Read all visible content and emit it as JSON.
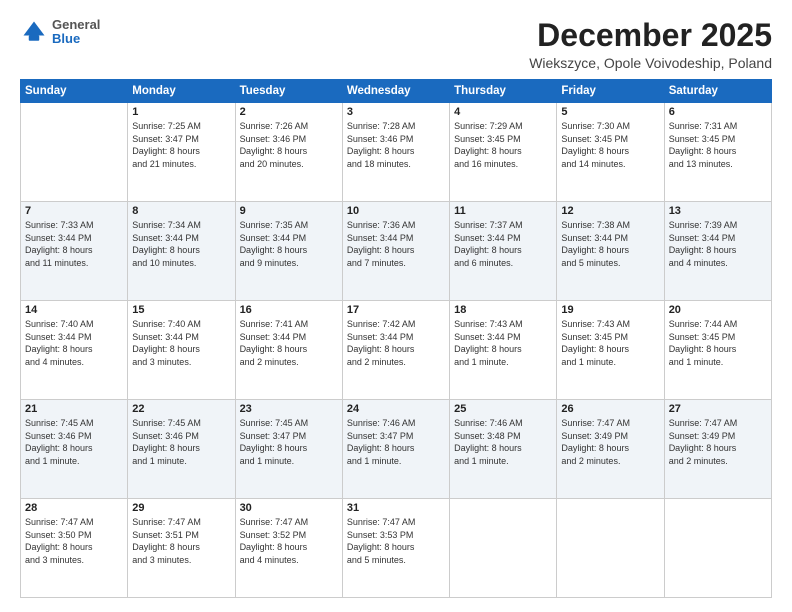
{
  "logo": {
    "general": "General",
    "blue": "Blue"
  },
  "header": {
    "month": "December 2025",
    "location": "Wiekszyce, Opole Voivodeship, Poland"
  },
  "weekdays": [
    "Sunday",
    "Monday",
    "Tuesday",
    "Wednesday",
    "Thursday",
    "Friday",
    "Saturday"
  ],
  "weeks": [
    [
      {
        "day": "",
        "info": ""
      },
      {
        "day": "1",
        "info": "Sunrise: 7:25 AM\nSunset: 3:47 PM\nDaylight: 8 hours\nand 21 minutes."
      },
      {
        "day": "2",
        "info": "Sunrise: 7:26 AM\nSunset: 3:46 PM\nDaylight: 8 hours\nand 20 minutes."
      },
      {
        "day": "3",
        "info": "Sunrise: 7:28 AM\nSunset: 3:46 PM\nDaylight: 8 hours\nand 18 minutes."
      },
      {
        "day": "4",
        "info": "Sunrise: 7:29 AM\nSunset: 3:45 PM\nDaylight: 8 hours\nand 16 minutes."
      },
      {
        "day": "5",
        "info": "Sunrise: 7:30 AM\nSunset: 3:45 PM\nDaylight: 8 hours\nand 14 minutes."
      },
      {
        "day": "6",
        "info": "Sunrise: 7:31 AM\nSunset: 3:45 PM\nDaylight: 8 hours\nand 13 minutes."
      }
    ],
    [
      {
        "day": "7",
        "info": "Sunrise: 7:33 AM\nSunset: 3:44 PM\nDaylight: 8 hours\nand 11 minutes."
      },
      {
        "day": "8",
        "info": "Sunrise: 7:34 AM\nSunset: 3:44 PM\nDaylight: 8 hours\nand 10 minutes."
      },
      {
        "day": "9",
        "info": "Sunrise: 7:35 AM\nSunset: 3:44 PM\nDaylight: 8 hours\nand 9 minutes."
      },
      {
        "day": "10",
        "info": "Sunrise: 7:36 AM\nSunset: 3:44 PM\nDaylight: 8 hours\nand 7 minutes."
      },
      {
        "day": "11",
        "info": "Sunrise: 7:37 AM\nSunset: 3:44 PM\nDaylight: 8 hours\nand 6 minutes."
      },
      {
        "day": "12",
        "info": "Sunrise: 7:38 AM\nSunset: 3:44 PM\nDaylight: 8 hours\nand 5 minutes."
      },
      {
        "day": "13",
        "info": "Sunrise: 7:39 AM\nSunset: 3:44 PM\nDaylight: 8 hours\nand 4 minutes."
      }
    ],
    [
      {
        "day": "14",
        "info": "Sunrise: 7:40 AM\nSunset: 3:44 PM\nDaylight: 8 hours\nand 4 minutes."
      },
      {
        "day": "15",
        "info": "Sunrise: 7:40 AM\nSunset: 3:44 PM\nDaylight: 8 hours\nand 3 minutes."
      },
      {
        "day": "16",
        "info": "Sunrise: 7:41 AM\nSunset: 3:44 PM\nDaylight: 8 hours\nand 2 minutes."
      },
      {
        "day": "17",
        "info": "Sunrise: 7:42 AM\nSunset: 3:44 PM\nDaylight: 8 hours\nand 2 minutes."
      },
      {
        "day": "18",
        "info": "Sunrise: 7:43 AM\nSunset: 3:44 PM\nDaylight: 8 hours\nand 1 minute."
      },
      {
        "day": "19",
        "info": "Sunrise: 7:43 AM\nSunset: 3:45 PM\nDaylight: 8 hours\nand 1 minute."
      },
      {
        "day": "20",
        "info": "Sunrise: 7:44 AM\nSunset: 3:45 PM\nDaylight: 8 hours\nand 1 minute."
      }
    ],
    [
      {
        "day": "21",
        "info": "Sunrise: 7:45 AM\nSunset: 3:46 PM\nDaylight: 8 hours\nand 1 minute."
      },
      {
        "day": "22",
        "info": "Sunrise: 7:45 AM\nSunset: 3:46 PM\nDaylight: 8 hours\nand 1 minute."
      },
      {
        "day": "23",
        "info": "Sunrise: 7:45 AM\nSunset: 3:47 PM\nDaylight: 8 hours\nand 1 minute."
      },
      {
        "day": "24",
        "info": "Sunrise: 7:46 AM\nSunset: 3:47 PM\nDaylight: 8 hours\nand 1 minute."
      },
      {
        "day": "25",
        "info": "Sunrise: 7:46 AM\nSunset: 3:48 PM\nDaylight: 8 hours\nand 1 minute."
      },
      {
        "day": "26",
        "info": "Sunrise: 7:47 AM\nSunset: 3:49 PM\nDaylight: 8 hours\nand 2 minutes."
      },
      {
        "day": "27",
        "info": "Sunrise: 7:47 AM\nSunset: 3:49 PM\nDaylight: 8 hours\nand 2 minutes."
      }
    ],
    [
      {
        "day": "28",
        "info": "Sunrise: 7:47 AM\nSunset: 3:50 PM\nDaylight: 8 hours\nand 3 minutes."
      },
      {
        "day": "29",
        "info": "Sunrise: 7:47 AM\nSunset: 3:51 PM\nDaylight: 8 hours\nand 3 minutes."
      },
      {
        "day": "30",
        "info": "Sunrise: 7:47 AM\nSunset: 3:52 PM\nDaylight: 8 hours\nand 4 minutes."
      },
      {
        "day": "31",
        "info": "Sunrise: 7:47 AM\nSunset: 3:53 PM\nDaylight: 8 hours\nand 5 minutes."
      },
      {
        "day": "",
        "info": ""
      },
      {
        "day": "",
        "info": ""
      },
      {
        "day": "",
        "info": ""
      }
    ]
  ]
}
